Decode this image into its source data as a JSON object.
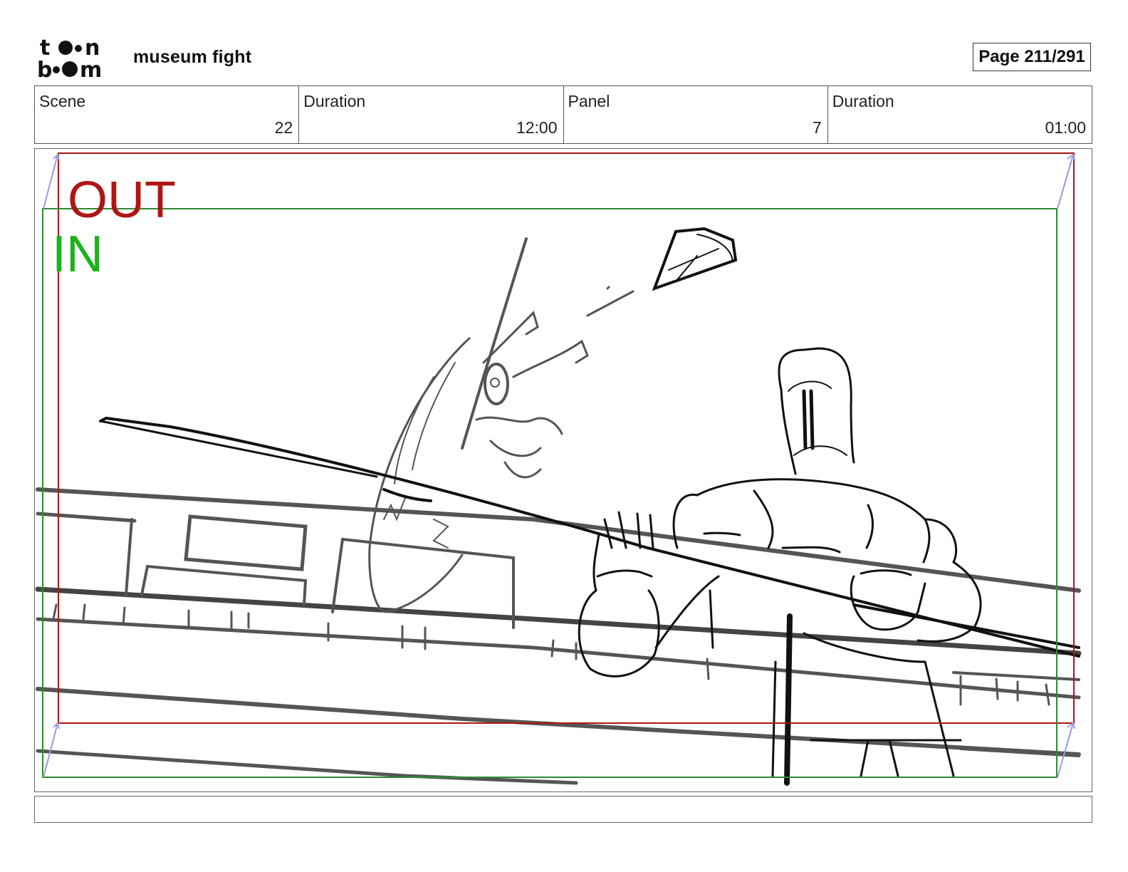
{
  "header": {
    "logo_text": "toonboom",
    "project_title": "museum fight",
    "page_indicator": "Page 211/291"
  },
  "info_table": {
    "columns": [
      {
        "label": "Scene",
        "value": "22"
      },
      {
        "label": "Duration",
        "value": "12:00"
      },
      {
        "label": "Panel",
        "value": "7"
      },
      {
        "label": "Duration",
        "value": "01:00"
      }
    ]
  },
  "panel": {
    "out_label": "OUT",
    "in_label": "IN",
    "colors": {
      "out_frame": "#b01515",
      "in_frame": "#2e8b2e",
      "in_text": "#18b418",
      "camera_arrows": "#9b9bdc",
      "sketch_dark": "#111111",
      "sketch_gray": "#555555"
    }
  },
  "notes": {
    "text": ""
  }
}
